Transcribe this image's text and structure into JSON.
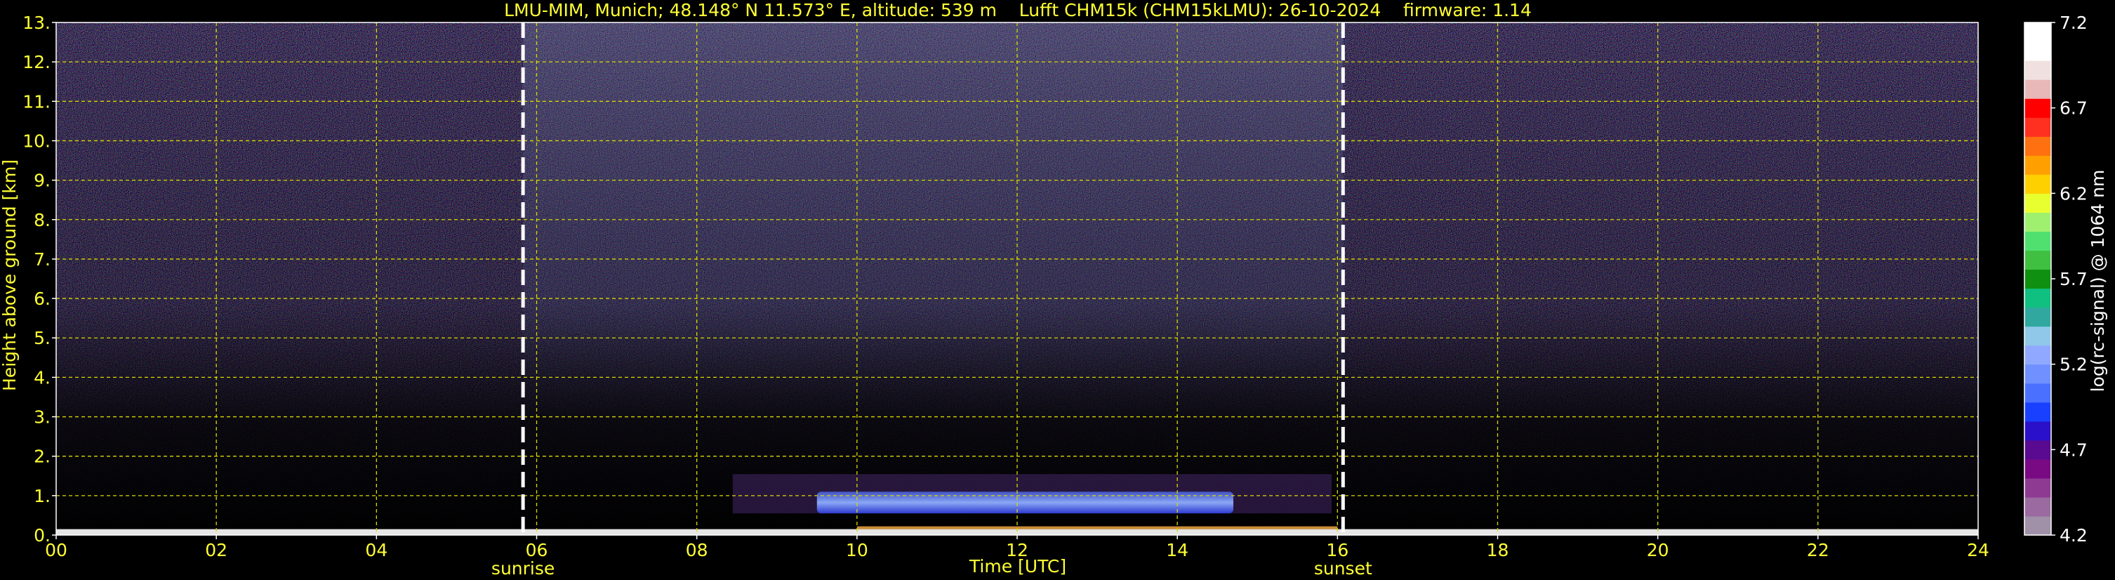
{
  "chart_data": {
    "type": "heatmap",
    "title": "LMU-MIM, Munich; 48.148° N 11.573° E, altitude: 539 m    Lufft CHM15k (CHM15kLMU): 26-10-2024    firmware: 1.14",
    "xlabel": "Time [UTC]",
    "ylabel": "Height above ground [km]",
    "xlim": [
      0,
      24
    ],
    "ylim": [
      0,
      13
    ],
    "x_ticks": [
      0,
      2,
      4,
      6,
      8,
      10,
      12,
      14,
      16,
      18,
      20,
      22,
      24
    ],
    "x_tick_labels": [
      "00",
      "02",
      "04",
      "06",
      "08",
      "10",
      "12",
      "14",
      "16",
      "18",
      "20",
      "22",
      "24"
    ],
    "y_ticks": [
      0,
      1,
      2,
      3,
      4,
      5,
      6,
      7,
      8,
      9,
      10,
      11,
      12,
      13
    ],
    "y_tick_labels": [
      "0.",
      "1.",
      "2.",
      "3.",
      "4.",
      "5.",
      "6.",
      "7.",
      "8.",
      "9.",
      "10.",
      "11.",
      "12.",
      "13."
    ],
    "grid": true,
    "markers": [
      {
        "label": "sunrise",
        "time": 5.83
      },
      {
        "label": "sunset",
        "time": 16.07
      }
    ],
    "colorbar": {
      "label": "log(rc-signal) @ 1064 nm",
      "range": [
        4.2,
        7.2
      ],
      "ticks": [
        4.2,
        4.7,
        5.2,
        5.7,
        6.2,
        6.7,
        7.2
      ],
      "tick_labels": [
        "4.2",
        "4.7",
        "5.2",
        "5.7",
        "6.2",
        "6.7",
        "7.2"
      ],
      "colors": [
        "#a090a8",
        "#9a6aa0",
        "#8e3a92",
        "#7a0a84",
        "#5a0a90",
        "#2a10c8",
        "#1a40ff",
        "#4a70ff",
        "#7090ff",
        "#90a8ff",
        "#8fc8e8",
        "#30a8a0",
        "#10c080",
        "#109010",
        "#40c040",
        "#50e070",
        "#a0f070",
        "#e8ff30",
        "#ffd000",
        "#ffa000",
        "#ff7010",
        "#ff3020",
        "#ff0000",
        "#e8b8b8",
        "#f0e0e0",
        "#ffffff",
        "#ffffff"
      ]
    },
    "features": {
      "aerosol_layer": {
        "time_start": 9.5,
        "time_end": 14.7,
        "height_bottom": 0.55,
        "height_top": 1.1
      },
      "ground_signal": {
        "time_start": 0,
        "time_end": 24,
        "height_top": 0.15
      }
    }
  }
}
